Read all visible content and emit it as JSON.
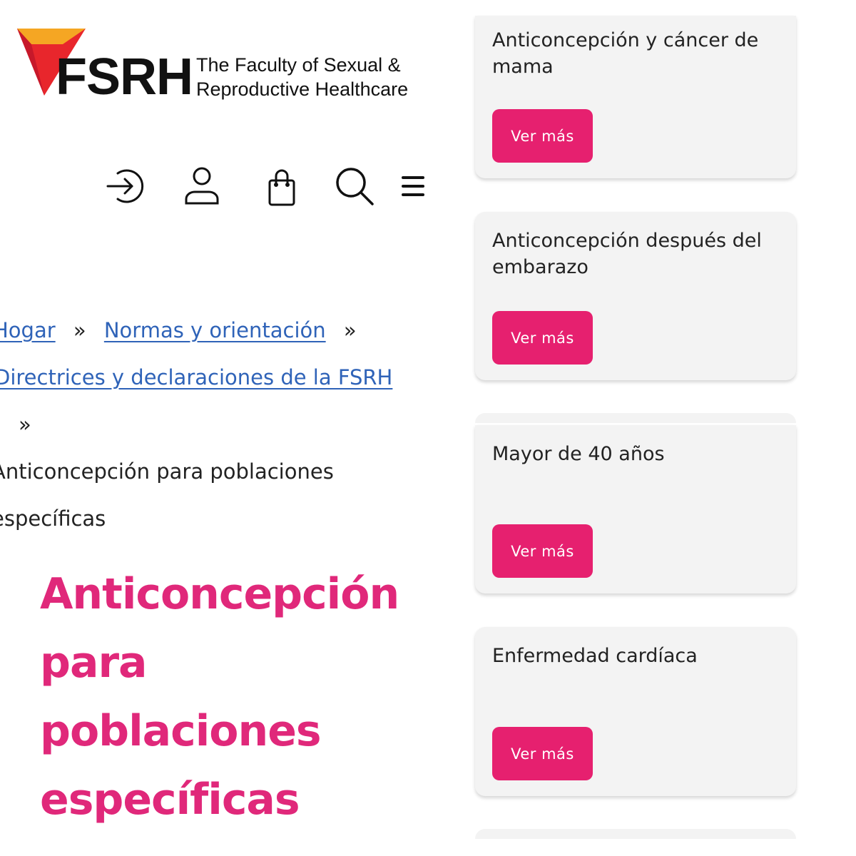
{
  "brand": {
    "name": "FSRH",
    "tagline_line1": "The Faculty of Sexual &",
    "tagline_line2": "Reproductive Healthcare",
    "colors": {
      "orange": "#f5a623",
      "red": "#e8262c",
      "magenta": "#e0287a",
      "pink_button": "#e6206f",
      "link_blue": "#2f63b8"
    }
  },
  "nav": {
    "icons": [
      "login-icon",
      "user-icon",
      "basket-icon",
      "search-icon",
      "menu-icon"
    ]
  },
  "breadcrumb": {
    "home": "Hogar",
    "sep": "»",
    "section": "Normas y orientación",
    "subsection": "Directrices y declaraciones de la FSRH",
    "current_line1": "Anticoncepción para poblaciones",
    "current_line2": "específicas"
  },
  "page": {
    "title": [
      "Anticoncepción",
      "para",
      "poblaciones",
      "específicas"
    ]
  },
  "cards": [
    {
      "title": "Anticoncepción y cáncer de mama",
      "button": "Ver más"
    },
    {
      "title": "Anticoncepción después del embarazo",
      "button": "Ver más"
    },
    {
      "title": "Mayor de 40 años",
      "button": "Ver más"
    },
    {
      "title": "Enfermedad cardíaca",
      "button": "Ver más"
    }
  ]
}
